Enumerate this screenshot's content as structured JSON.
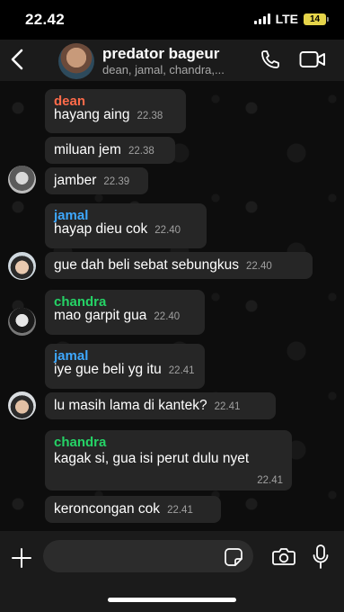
{
  "status_bar": {
    "time": "22.42",
    "network": "LTE",
    "battery": "14",
    "battery_color": "#e5d44a"
  },
  "header": {
    "title": "predator bageur",
    "subtitle": "dean, jamal, chandra,...",
    "icons": {
      "back": "chevron-left-icon",
      "call": "phone-icon",
      "video": "video-camera-icon"
    }
  },
  "messages": [
    {
      "sender": "dean",
      "sender_color": "#ff6b4a",
      "text": "hayang aing",
      "time": "22.38"
    },
    {
      "text": "miluan jem",
      "time": "22.38"
    },
    {
      "text": "jamber",
      "time": "22.39"
    },
    {
      "sender": "jamal",
      "sender_color": "#3ea8ff",
      "text": "hayap dieu cok",
      "time": "22.40"
    },
    {
      "text": "gue dah beli sebat sebungkus",
      "time": "22.40"
    },
    {
      "sender": "chandra",
      "sender_color": "#25d366",
      "text": "mao garpit gua",
      "time": "22.40"
    },
    {
      "sender": "jamal",
      "sender_color": "#3ea8ff",
      "text": "iye gue beli yg itu",
      "time": "22.41"
    },
    {
      "text": "lu masih lama di kantek?",
      "time": "22.41"
    },
    {
      "sender": "chandra",
      "sender_color": "#25d366",
      "text": "kagak si, gua isi perut dulu nyet",
      "time": "22.41"
    },
    {
      "text": "keroncongan cok",
      "time": "22.41"
    }
  ],
  "composer": {
    "placeholder": "",
    "icons": {
      "attach": "plus-icon",
      "sticker": "sticker-icon",
      "camera": "camera-icon",
      "voice": "microphone-icon"
    }
  },
  "theme": {
    "bubble": "#262626",
    "bar": "#1b1b1b"
  }
}
